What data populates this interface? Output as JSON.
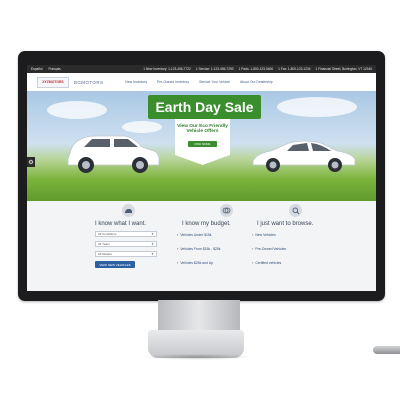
{
  "topbar": {
    "left": [
      "Español",
      "Français"
    ],
    "right": [
      "1 New Inventory: 1-123-456-7722",
      "1 Service: 1-123-456-7293",
      "1 Parts: 1-800-123-0406",
      "1 Fax: 1-800-123-1234",
      "1 Financial Street, Burlington, VT 12345"
    ]
  },
  "header": {
    "logo_text": "XYZMOTORS",
    "brand": "BGMOTORS",
    "nav": [
      "New Inventory",
      "Pre-Owned Inventory",
      "Service Your Vehicle",
      "About Our Dealership"
    ]
  },
  "hero": {
    "banner": "Earth Day Sale",
    "offer_text": "View Our Eco Friendly Vehicle Offers",
    "offer_button": "FIND MORE"
  },
  "columns": {
    "want": {
      "title": "I know what I want.",
      "selects": [
        "All Conditions",
        "All Years",
        "All Models"
      ],
      "button": "VIEW NEW VEHICLES"
    },
    "budget": {
      "title": "I know my budget.",
      "links": [
        "Vehicles Under $15k",
        "Vehicles From $15k - $25k",
        "Vehicles $25k and Up"
      ]
    },
    "browse": {
      "title": "I just want to browse.",
      "links": [
        "New Vehicles",
        "Pre-Owned Vehicles",
        "Certified vehicles"
      ]
    }
  },
  "icons": [
    "car-icon",
    "money-icon",
    "search-icon",
    "gear-icon"
  ]
}
